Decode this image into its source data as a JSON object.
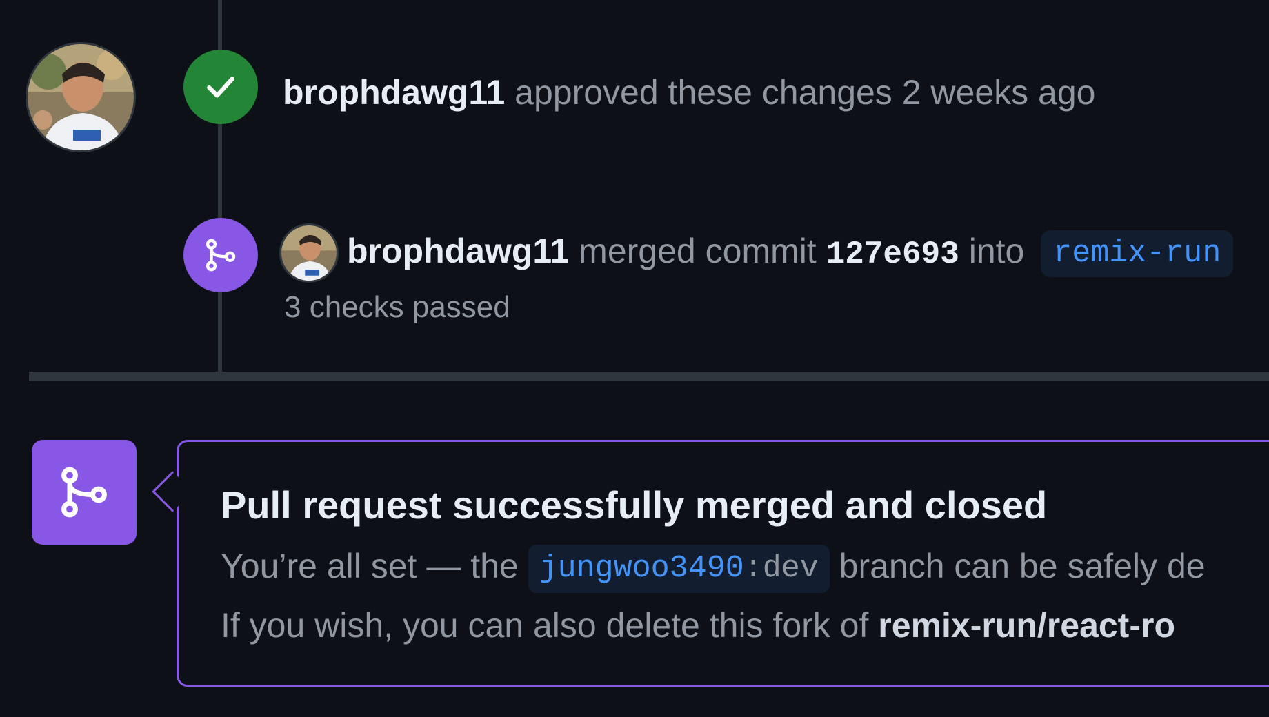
{
  "timeline": {
    "approved": {
      "user": "brophdawg11",
      "text": "approved these changes",
      "time": "2 weeks ago"
    },
    "merged": {
      "user": "brophdawg11",
      "text_before": "merged commit",
      "commit": "127e693",
      "text_into": "into",
      "branch": "remix-run",
      "checks": "3 checks passed"
    }
  },
  "merge_box": {
    "title": "Pull request successfully merged and closed",
    "line1_before": "You’re all set — the",
    "branch_owner": "jungwoo3490",
    "branch_sep": ":",
    "branch_name": "dev",
    "line1_after": "branch can be safely de",
    "line2_before": "If you wish, you can also delete this fork of",
    "fork_repo": "remix-run/react-ro"
  },
  "colors": {
    "background": "#0d1117",
    "approved_green": "#238636",
    "merged_purple": "#8957e5",
    "link_blue": "#4493f8"
  },
  "icons": {
    "approved": "check-icon",
    "merged": "git-merge-icon"
  }
}
